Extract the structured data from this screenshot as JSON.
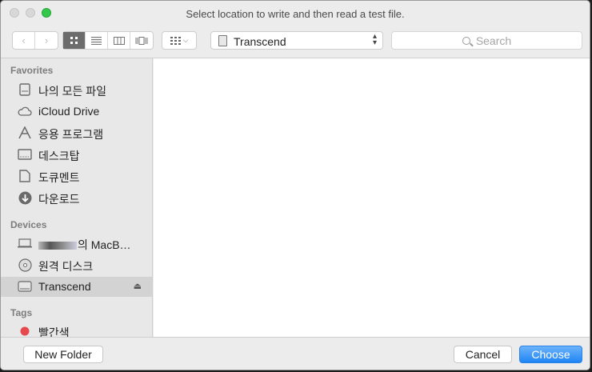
{
  "window": {
    "title": "Select location to write and then read a test file."
  },
  "toolbar": {
    "back_icon": "chevron-left-icon",
    "forward_icon": "chevron-right-icon",
    "view_modes": [
      "icon-view",
      "list-view",
      "column-view",
      "cover-flow-view"
    ],
    "active_view": "icon-view",
    "arrange_icon": "arrange-grid-icon",
    "location": "Transcend",
    "search_placeholder": "Search"
  },
  "sidebar": {
    "favorites_header": "Favorites",
    "favorites": [
      {
        "label": "나의 모든 파일",
        "icon": "all-files-icon"
      },
      {
        "label": "iCloud Drive",
        "icon": "cloud-icon"
      },
      {
        "label": "응용 프로그램",
        "icon": "applications-icon"
      },
      {
        "label": "데스크탑",
        "icon": "desktop-icon"
      },
      {
        "label": "도큐멘트",
        "icon": "documents-icon"
      },
      {
        "label": "다운로드",
        "icon": "downloads-icon"
      }
    ],
    "devices_header": "Devices",
    "devices": [
      {
        "label": "의 MacB…",
        "icon": "laptop-icon"
      },
      {
        "label": "원격 디스크",
        "icon": "remote-disc-icon"
      },
      {
        "label": "Transcend",
        "icon": "external-drive-icon",
        "selected": true
      }
    ],
    "tags_header": "Tags",
    "tags": [
      {
        "label": "빨간색",
        "color": "#e5484d"
      }
    ]
  },
  "footer": {
    "new_folder": "New Folder",
    "cancel": "Cancel",
    "choose": "Choose"
  },
  "colors": {
    "accent": "#1f85f5",
    "zoom_button": "#34c84a",
    "tag_red": "#e5484d"
  }
}
